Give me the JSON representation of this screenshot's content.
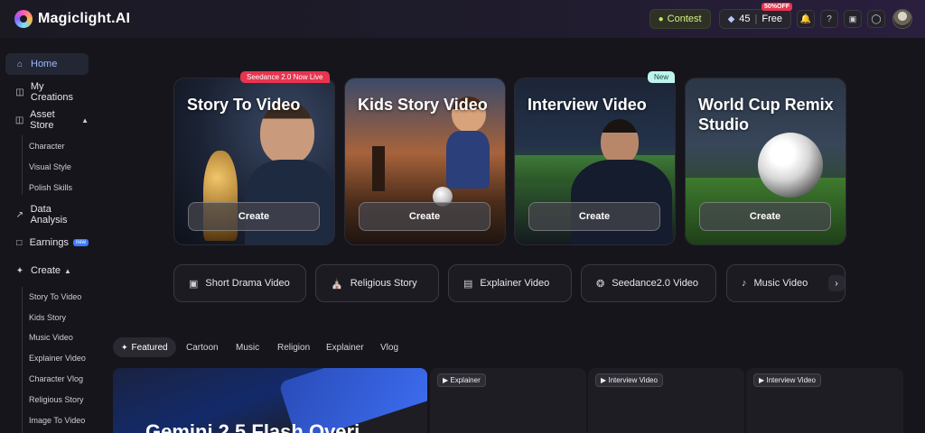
{
  "app": {
    "name": "Magiclight.AI"
  },
  "header": {
    "contest_label": "Contest",
    "credits_value": "45",
    "plan_label": "Free",
    "discount_badge": "50%OFF"
  },
  "sidebar": {
    "home": "Home",
    "my_creations": "My Creations",
    "asset_store": "Asset Store",
    "asset_store_items": [
      "Character",
      "Visual Style",
      "Polish Skills"
    ],
    "data_analysis": "Data Analysis",
    "earnings": "Earnings",
    "earnings_badge": "new",
    "create": "Create",
    "create_items": [
      "Story To Video",
      "Kids Story",
      "Music Video",
      "Explainer Video",
      "Character Vlog",
      "Religious Story",
      "Image To Video"
    ]
  },
  "cards": [
    {
      "title": "Story To Video",
      "button": "Create",
      "badge": "Seedance 2.0 Now Live"
    },
    {
      "title": "Kids Story Video",
      "button": "Create",
      "badge": ""
    },
    {
      "title": "Interview Video",
      "button": "Create",
      "badge": "New"
    },
    {
      "title": "World Cup Remix Studio",
      "button": "Create",
      "badge": ""
    }
  ],
  "categories": [
    "Short Drama Video",
    "Religious Story",
    "Explainer Video",
    "Seedance2.0 Video",
    "Music Video"
  ],
  "filter_tabs": [
    "Featured",
    "Cartoon",
    "Music",
    "Religion",
    "Explainer",
    "Vlog"
  ],
  "gallery": {
    "featured_text": "Gemini 2.5 Flash Overi",
    "tags": [
      "Explainer",
      "Interview Video",
      "Interview Video"
    ]
  },
  "colors": {
    "accent": "#9db7ff",
    "badge_red": "#e8344e",
    "badge_new": "#bff4ee",
    "background": "#16151b"
  }
}
